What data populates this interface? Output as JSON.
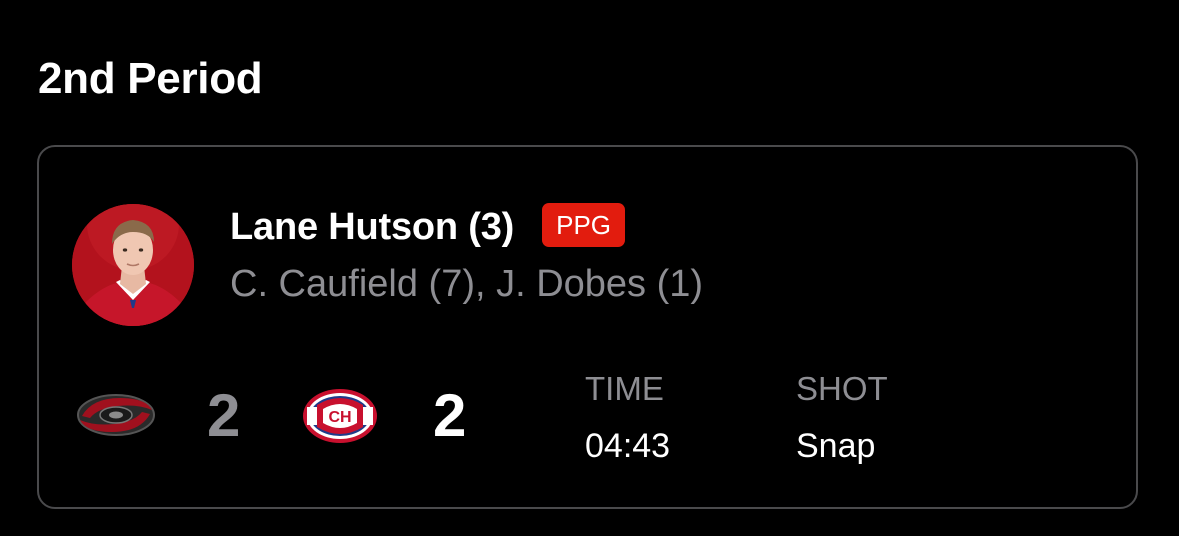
{
  "period": {
    "title": "2nd Period"
  },
  "goal": {
    "scorer": "Lane Hutson (3)",
    "badge": "PPG",
    "assists": "C. Caufield (7), J. Dobes (1)",
    "headshot_icon": "player-headshot-icon"
  },
  "score": {
    "away_team_icon": "carolina-hurricanes-logo-icon",
    "away": "2",
    "home_team_icon": "montreal-canadiens-logo-icon",
    "home": "2"
  },
  "stats": {
    "time_label": "TIME",
    "time_value": "04:43",
    "shot_label": "SHOT",
    "shot_value": "Snap"
  },
  "colors": {
    "background": "#000000",
    "card_border": "#4a4a4c",
    "badge": "#e21c0e",
    "muted_text": "#8e8e93",
    "primary_text": "#ffffff"
  }
}
